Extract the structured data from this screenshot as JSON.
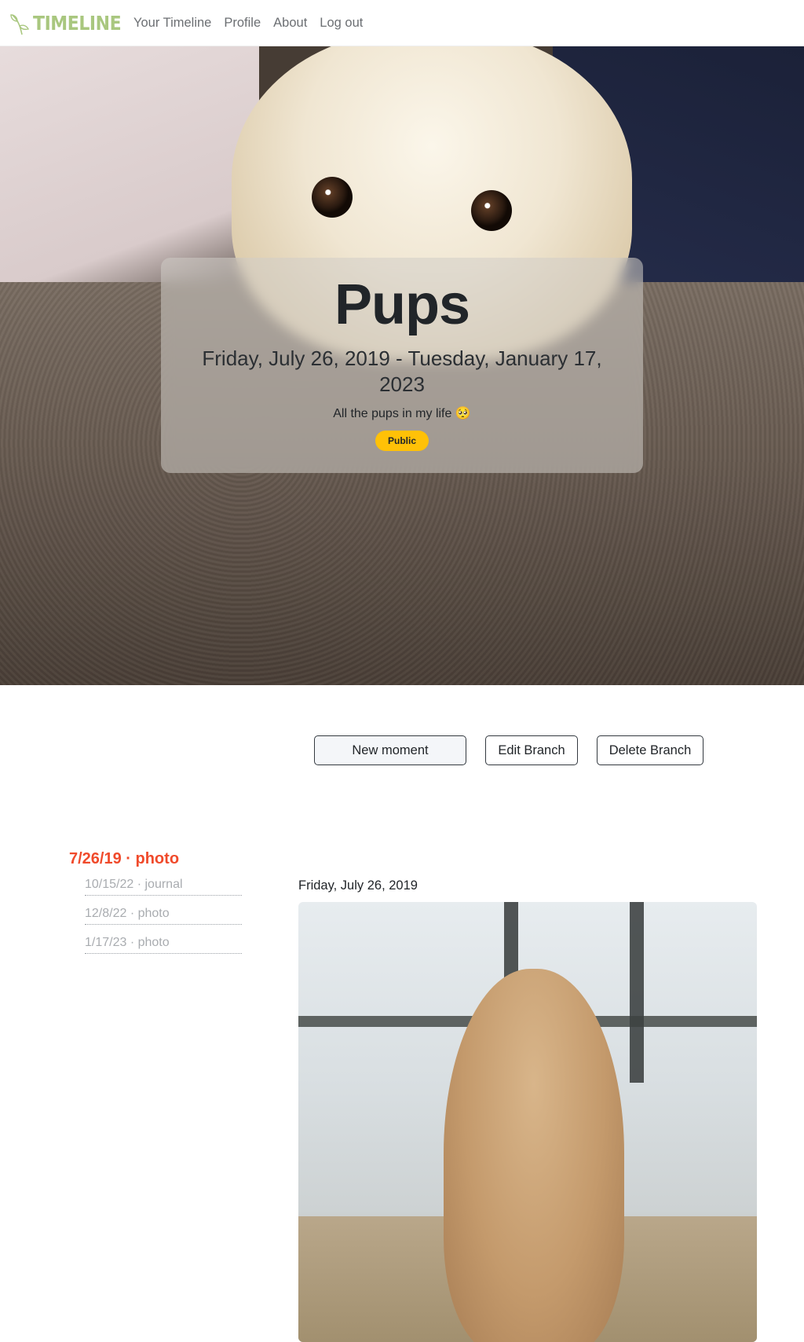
{
  "navbar": {
    "brand": "TIMELINE",
    "links": [
      "Your Timeline",
      "Profile",
      "About",
      "Log out"
    ]
  },
  "hero": {
    "title": "Pups",
    "dates": "Friday, July 26, 2019 - Tuesday, January 17, 2023",
    "description": "All the pups in my life 🥺",
    "badge": "Public"
  },
  "actions": {
    "new_moment": "New moment",
    "edit_branch": "Edit Branch",
    "delete_branch": "Delete Branch"
  },
  "timeline": {
    "active": "7/26/19 · photo",
    "items": [
      "10/15/22 · journal",
      "12/8/22 · photo",
      "1/17/23 · photo"
    ]
  },
  "moment": {
    "date": "Friday, July 26, 2019"
  },
  "colors": {
    "brand": "#a9c77f",
    "active_item": "#f04a2b",
    "badge": "#ffc107"
  }
}
